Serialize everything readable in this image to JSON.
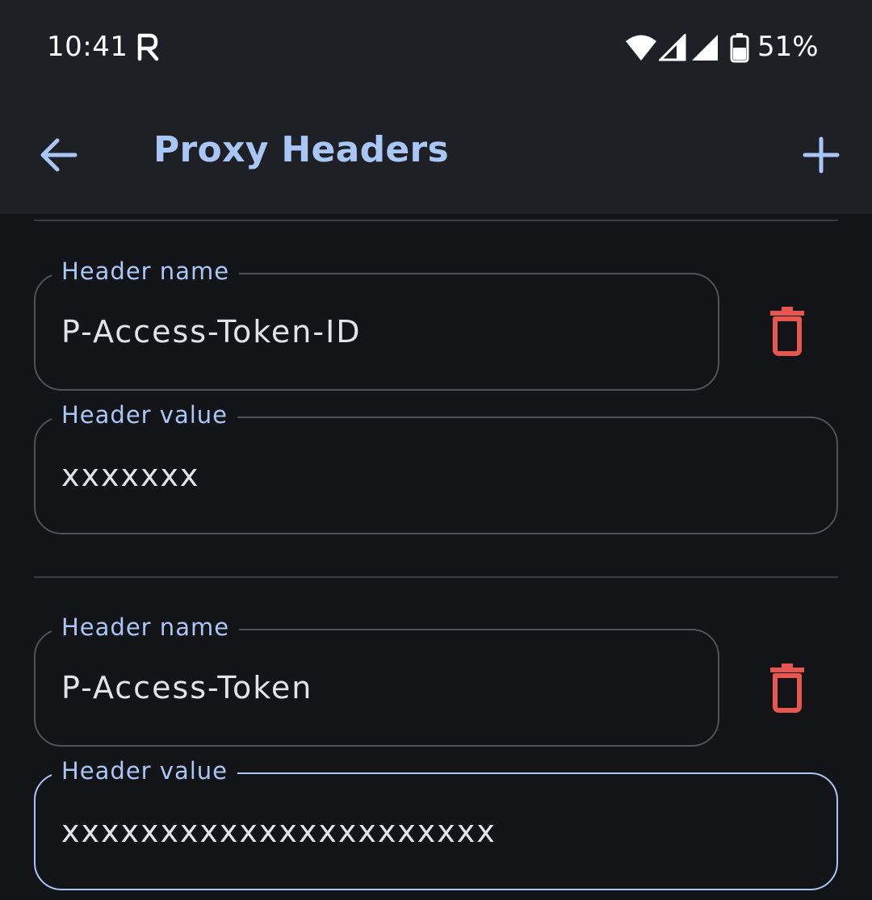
{
  "status_bar": {
    "time": "10:41",
    "carrier_icon": "r-carrier-icon",
    "battery_percent": "51%",
    "icons": [
      "wifi-icon",
      "signal-icon",
      "signal-icon",
      "battery-icon"
    ]
  },
  "app_bar": {
    "title": "Proxy Headers",
    "back_icon": "arrow-left-icon",
    "add_icon": "plus-icon"
  },
  "headers": [
    {
      "name_label": "Header name",
      "name_value": "P-Access-Token-ID",
      "value_label": "Header value",
      "value_value": "xxxxxxx",
      "delete_icon": "trash-icon"
    },
    {
      "name_label": "Header name",
      "name_value": "P-Access-Token",
      "value_label": "Header value",
      "value_value": "xxxxxxxxxxxxxxxxxxxxxx",
      "delete_icon": "trash-icon"
    }
  ],
  "colors": {
    "accent": "#a9c7f6",
    "delete": "#e8574f",
    "background": "#131418",
    "app_bar": "#1e2025"
  }
}
